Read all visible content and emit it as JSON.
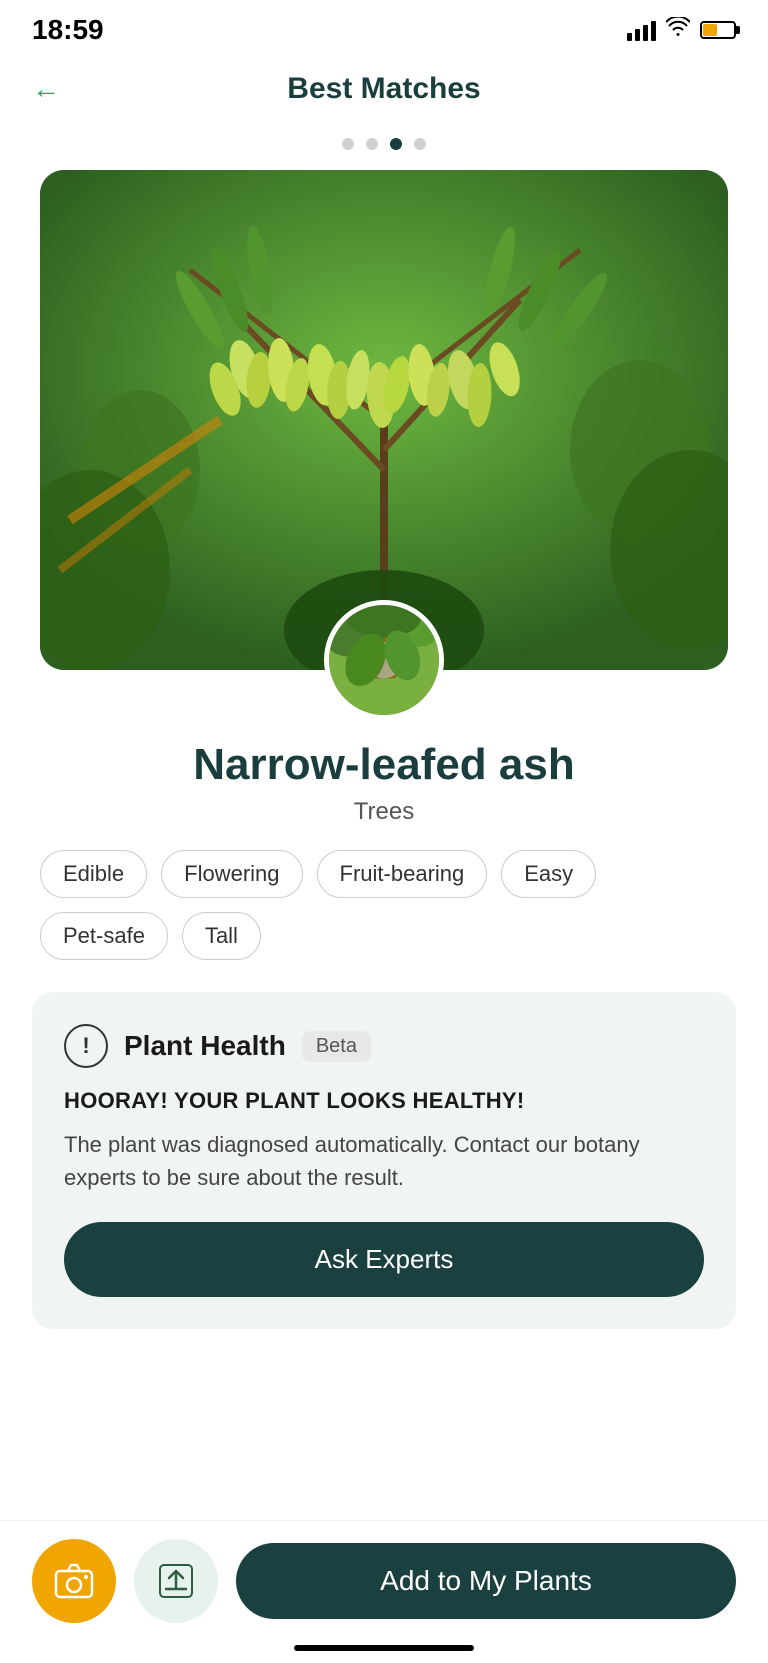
{
  "statusBar": {
    "time": "18:59"
  },
  "header": {
    "back_label": "←",
    "title": "Best Matches"
  },
  "pagination": {
    "dots": [
      {
        "active": false
      },
      {
        "active": false
      },
      {
        "active": true
      },
      {
        "active": false
      }
    ]
  },
  "plant": {
    "name": "Narrow-leafed ash",
    "category": "Trees",
    "tags": [
      "Edible",
      "Flowering",
      "Fruit-bearing",
      "Easy",
      "Pet-safe",
      "Tall"
    ]
  },
  "healthCard": {
    "icon_label": "!",
    "title": "Plant Health",
    "beta_label": "Beta",
    "headline": "HOORAY! YOUR PLANT LOOKS HEALTHY!",
    "description": "The plant was diagnosed automatically. Contact our botany experts to be sure about the result.",
    "button_label": "Ask Experts"
  },
  "bottomBar": {
    "add_plants_label": "Add to My Plants"
  }
}
